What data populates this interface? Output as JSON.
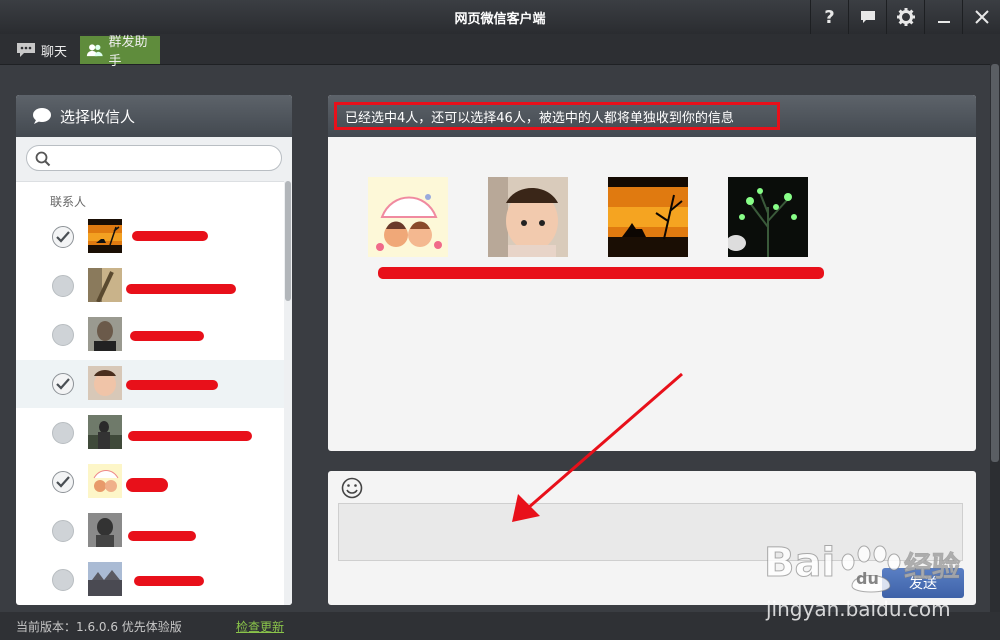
{
  "window": {
    "title": "网页微信客户端",
    "controls": [
      "help-icon",
      "feedback-icon",
      "settings-icon",
      "minimize-icon",
      "close-icon"
    ]
  },
  "tabs": [
    {
      "label": "聊天",
      "icon": "chat-bubble-icon",
      "active": false
    },
    {
      "label": "群发助手",
      "icon": "contacts-icon",
      "active": true
    }
  ],
  "recipients_panel": {
    "title": "选择收信人",
    "search_placeholder": "",
    "section_label": "联系人",
    "contacts": [
      {
        "checked": true,
        "name_redacted": true
      },
      {
        "checked": false,
        "name_redacted": true
      },
      {
        "checked": false,
        "name_redacted": true
      },
      {
        "checked": true,
        "name_redacted": true
      },
      {
        "checked": false,
        "name_redacted": true
      },
      {
        "checked": true,
        "name_redacted": true
      },
      {
        "checked": false,
        "name_redacted": true
      },
      {
        "checked": false,
        "name_redacted": true
      }
    ]
  },
  "selection_panel": {
    "notice": "已经选中4人，还可以选择46人，被选中的人都将单独收到你的信息",
    "selected_count": 4,
    "remaining": 46
  },
  "compose": {
    "message_value": "",
    "send_label": "发送"
  },
  "footer": {
    "version_text": "当前版本：1.6.0.6 优先体验版",
    "update_link": "检查更新"
  },
  "watermark": {
    "logo_text": "Baidu经验",
    "url_text": "jingyan.baidu.com"
  },
  "colors": {
    "accent_green": "#5f8c3c",
    "annotation_red": "#e8101a",
    "send_blue": "#4a6fb6"
  }
}
